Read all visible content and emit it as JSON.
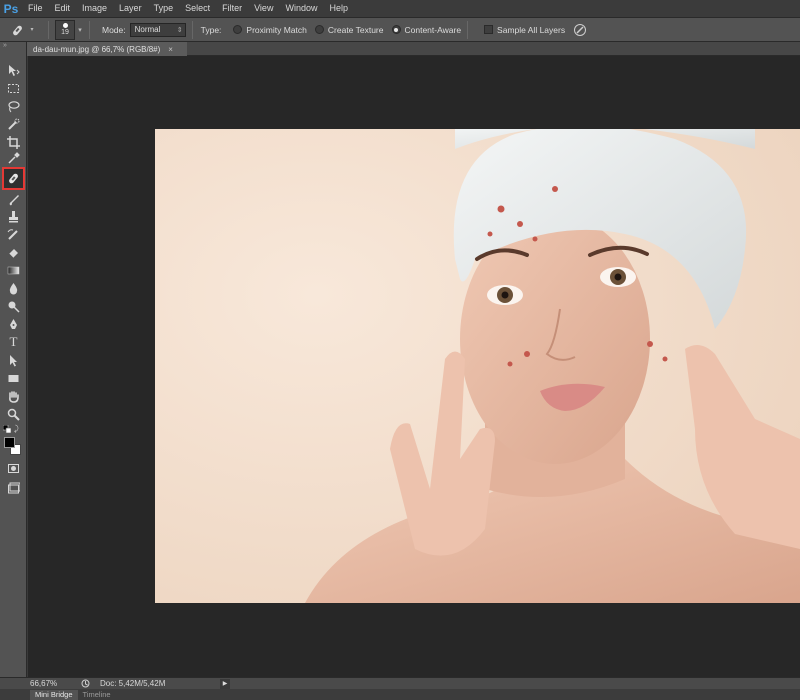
{
  "app": {
    "logo": "Ps"
  },
  "menu": [
    "File",
    "Edit",
    "Image",
    "Layer",
    "Type",
    "Select",
    "Filter",
    "View",
    "Window",
    "Help"
  ],
  "options": {
    "tool_icon": "spot-healing-brush-icon",
    "brush_size": "19",
    "mode_label": "Mode:",
    "mode_value": "Normal",
    "type_label": "Type:",
    "type_options": [
      "Proximity Match",
      "Create Texture",
      "Content-Aware"
    ],
    "type_selected": "Content-Aware",
    "sample_all_layers": "Sample All Layers"
  },
  "document_tab": {
    "title": "da-dau-mun.jpg @ 66,7% (RGB/8#)",
    "close": "×"
  },
  "toolbox": {
    "grip": "»",
    "tools": [
      "move-tool-icon",
      "marquee-tool-icon",
      "lasso-tool-icon",
      "quick-selection-tool-icon",
      "crop-tool-icon",
      "eyedropper-tool-icon",
      "spot-healing-brush-tool-icon",
      "brush-tool-icon",
      "clone-stamp-tool-icon",
      "history-brush-tool-icon",
      "eraser-tool-icon",
      "gradient-tool-icon",
      "blur-tool-icon",
      "dodge-tool-icon",
      "pen-tool-icon",
      "type-tool-icon",
      "path-selection-tool-icon",
      "rectangle-tool-icon",
      "hand-tool-icon",
      "zoom-tool-icon"
    ],
    "active_tool": "spot-healing-brush-tool-icon",
    "type_tool_glyph": "T"
  },
  "status": {
    "zoom": "66,67%",
    "doc_size": "Doc: 5,42M/5,42M",
    "arrow": "▶"
  },
  "bottom_tabs": [
    "Mini Bridge",
    "Timeline"
  ],
  "colors": {
    "accent_highlight": "#e53935",
    "foreground": "#000000",
    "background": "#ffffff"
  }
}
